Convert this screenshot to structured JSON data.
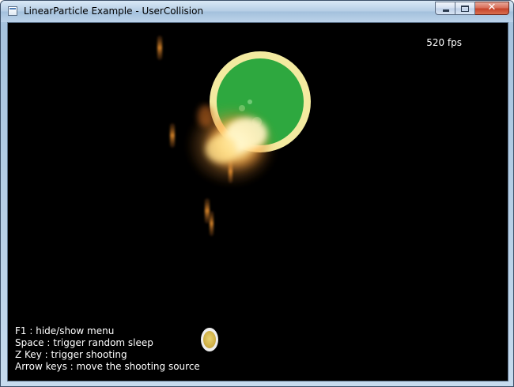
{
  "window": {
    "title": "LinearParticle Example - UserCollision",
    "close_glyph": "✕"
  },
  "overlay": {
    "fps_text": "520 fps",
    "help_lines": [
      "F1 : hide/show menu",
      "Space : trigger random sleep",
      "Z Key : trigger shooting",
      "Arrow keys : move the shooting source"
    ]
  },
  "colors": {
    "background": "#000000",
    "sphere_fill": "#2ea83f",
    "sphere_ring": "#f3eaa0",
    "explosion_core": "#fff6c8",
    "explosion_outer": "#ff9a2e",
    "trail": "#d9862a",
    "shooter_fill": "#d8c25a",
    "shooter_ring": "#eeeeee",
    "text": "#ffffff"
  }
}
